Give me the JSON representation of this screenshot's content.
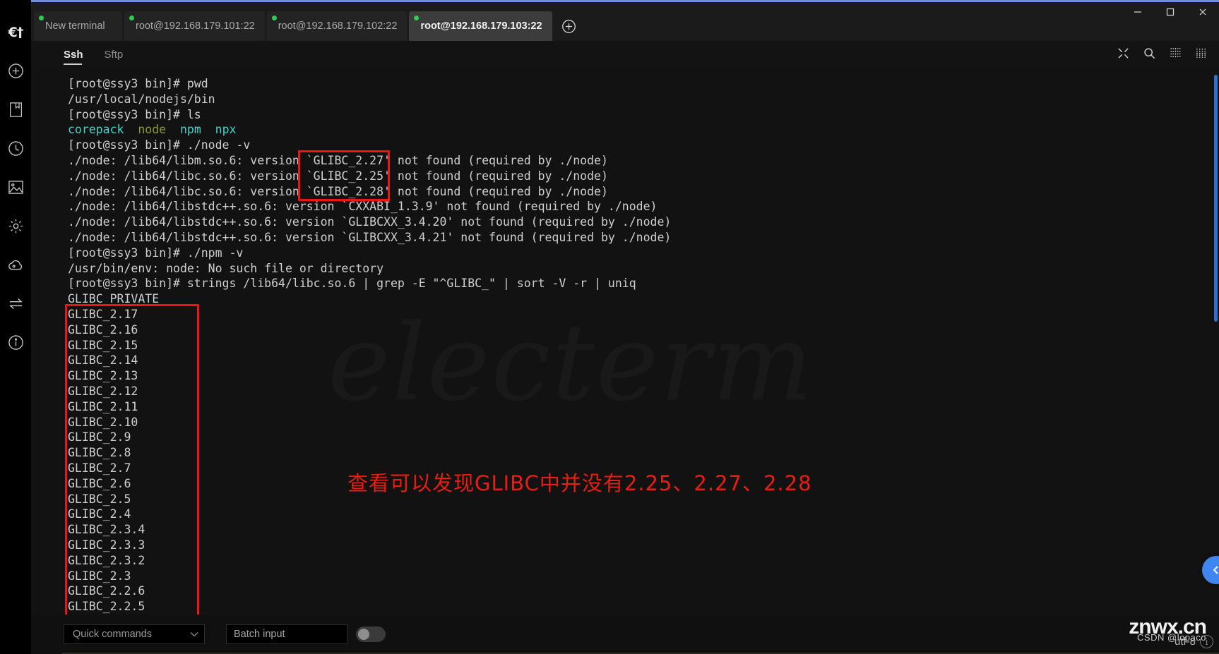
{
  "window": {
    "controls": {
      "minimize": "—",
      "maximize": "□",
      "close": "✕"
    }
  },
  "sidebar": {
    "items": [
      {
        "label": "€†",
        "icon": "electerm-logo-icon",
        "name": "app-logo"
      },
      {
        "label": "",
        "icon": "plus-circle-icon",
        "name": "new-connection"
      },
      {
        "label": "",
        "icon": "bookmark-icon",
        "name": "bookmarks"
      },
      {
        "label": "",
        "icon": "clock-icon",
        "name": "history"
      },
      {
        "label": "",
        "icon": "image-icon",
        "name": "themes"
      },
      {
        "label": "",
        "icon": "gear-icon",
        "name": "settings"
      },
      {
        "label": "",
        "icon": "cloud-icon",
        "name": "sync"
      },
      {
        "label": "",
        "icon": "transfer-icon",
        "name": "transfer"
      },
      {
        "label": "",
        "icon": "info-icon",
        "name": "about"
      }
    ]
  },
  "tabs": [
    {
      "label": "New terminal",
      "active": false,
      "status": "connected"
    },
    {
      "label": "root@192.168.179.101:22",
      "active": false,
      "status": "connected"
    },
    {
      "label": "root@192.168.179.102:22",
      "active": false,
      "status": "connected"
    },
    {
      "label": "root@192.168.179.103:22",
      "active": true,
      "status": "connected"
    }
  ],
  "tab_add_label": "+",
  "subtabs": [
    {
      "label": "Ssh",
      "active": true
    },
    {
      "label": "Sftp",
      "active": false
    }
  ],
  "toolbar_icons": [
    {
      "name": "fullscreen-icon"
    },
    {
      "name": "search-icon"
    },
    {
      "name": "split-vertical-icon"
    },
    {
      "name": "split-grid-icon"
    }
  ],
  "terminal": {
    "watermark": "electerm",
    "lines": [
      {
        "segments": [
          {
            "text": "[root@ssy3 bin]# pwd"
          }
        ]
      },
      {
        "segments": [
          {
            "text": "/usr/local/nodejs/bin"
          }
        ]
      },
      {
        "segments": [
          {
            "text": "[root@ssy3 bin]# ls"
          }
        ]
      },
      {
        "segments": [
          {
            "text": "corepack",
            "color": "cyan"
          },
          {
            "text": "  "
          },
          {
            "text": "node",
            "color": "olive"
          },
          {
            "text": "  "
          },
          {
            "text": "npm",
            "color": "cyan"
          },
          {
            "text": "  "
          },
          {
            "text": "npx",
            "color": "cyan"
          }
        ]
      },
      {
        "segments": [
          {
            "text": "[root@ssy3 bin]# ./node -v"
          }
        ]
      },
      {
        "segments": [
          {
            "text": "./node: /lib64/libm.so.6: version `GLIBC_2.27' not found (required by ./node)"
          }
        ]
      },
      {
        "segments": [
          {
            "text": "./node: /lib64/libc.so.6: version `GLIBC_2.25' not found (required by ./node)"
          }
        ]
      },
      {
        "segments": [
          {
            "text": "./node: /lib64/libc.so.6: version `GLIBC_2.28' not found (required by ./node)"
          }
        ]
      },
      {
        "segments": [
          {
            "text": "./node: /lib64/libstdc++.so.6: version `CXXABI_1.3.9' not found (required by ./node)"
          }
        ]
      },
      {
        "segments": [
          {
            "text": "./node: /lib64/libstdc++.so.6: version `GLIBCXX_3.4.20' not found (required by ./node)"
          }
        ]
      },
      {
        "segments": [
          {
            "text": "./node: /lib64/libstdc++.so.6: version `GLIBCXX_3.4.21' not found (required by ./node)"
          }
        ]
      },
      {
        "segments": [
          {
            "text": "[root@ssy3 bin]# ./npm -v"
          }
        ]
      },
      {
        "segments": [
          {
            "text": "/usr/bin/env: node: No such file or directory"
          }
        ]
      },
      {
        "segments": [
          {
            "text": "[root@ssy3 bin]# strings /lib64/libc.so.6 | grep -E \"^GLIBC_\" | sort -V -r | uniq"
          }
        ]
      },
      {
        "segments": [
          {
            "text": "GLIBC_PRIVATE"
          }
        ]
      },
      {
        "segments": [
          {
            "text": "GLIBC_2.17"
          }
        ]
      },
      {
        "segments": [
          {
            "text": "GLIBC_2.16"
          }
        ]
      },
      {
        "segments": [
          {
            "text": "GLIBC_2.15"
          }
        ]
      },
      {
        "segments": [
          {
            "text": "GLIBC_2.14"
          }
        ]
      },
      {
        "segments": [
          {
            "text": "GLIBC_2.13"
          }
        ]
      },
      {
        "segments": [
          {
            "text": "GLIBC_2.12"
          }
        ]
      },
      {
        "segments": [
          {
            "text": "GLIBC_2.11"
          }
        ]
      },
      {
        "segments": [
          {
            "text": "GLIBC_2.10"
          }
        ]
      },
      {
        "segments": [
          {
            "text": "GLIBC_2.9"
          }
        ]
      },
      {
        "segments": [
          {
            "text": "GLIBC_2.8"
          }
        ]
      },
      {
        "segments": [
          {
            "text": "GLIBC_2.7"
          }
        ]
      },
      {
        "segments": [
          {
            "text": "GLIBC_2.6"
          }
        ]
      },
      {
        "segments": [
          {
            "text": "GLIBC_2.5"
          }
        ]
      },
      {
        "segments": [
          {
            "text": "GLIBC_2.4"
          }
        ]
      },
      {
        "segments": [
          {
            "text": "GLIBC_2.3.4"
          }
        ]
      },
      {
        "segments": [
          {
            "text": "GLIBC_2.3.3"
          }
        ]
      },
      {
        "segments": [
          {
            "text": "GLIBC_2.3.2"
          }
        ]
      },
      {
        "segments": [
          {
            "text": "GLIBC_2.3"
          }
        ]
      },
      {
        "segments": [
          {
            "text": "GLIBC_2.2.6"
          }
        ]
      },
      {
        "segments": [
          {
            "text": "GLIBC_2.2.5"
          }
        ]
      }
    ]
  },
  "annotations": {
    "note_text": "查看可以发现GLIBC中并没有2.25、2.27、2.28",
    "note_color": "#e81e12",
    "box_color": "#f01515"
  },
  "bottom": {
    "quick_commands_label": "Quick commands",
    "batch_input_label": "Batch input",
    "batch_input_enabled": false,
    "encoding": "utf-8"
  },
  "watermark_bottom": {
    "big": "znwx.cn",
    "small": "CSDN @lopaco"
  },
  "colors": {
    "accent_blue": "#3f86f0",
    "tab_active_bg": "#3c3c3c",
    "terminal_bg": "#121212",
    "status_green": "#2ecc50"
  }
}
